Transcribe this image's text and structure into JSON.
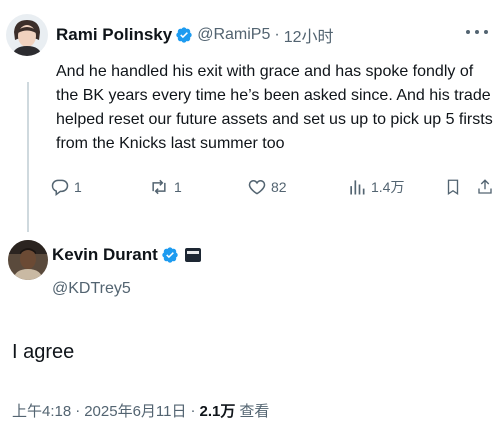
{
  "reply_tweet": {
    "author_name": "Rami Polinsky",
    "author_handle": "@RamiP5",
    "separator": "·",
    "time_ago": "12小时",
    "text": "And he handled his exit with grace and has spoke fondly of the BK years every time he’s been asked since. And his trade helped reset our future assets and set us up to pick up 5 firsts from the Knicks last summer too",
    "actions": {
      "replies": "1",
      "reposts": "1",
      "likes": "82",
      "views": "1.4万"
    }
  },
  "main_tweet": {
    "author_name": "Kevin Durant",
    "author_handle": "@KDTrey5",
    "text": "I agree",
    "time": "上午4:18",
    "date": "2025年6月11日",
    "separator": "·",
    "views_count": "2.1万",
    "views_label": "查看"
  },
  "colors": {
    "text": "#0f1419",
    "secondary": "#536471",
    "verified": "#1d9bf0",
    "thread_line": "#cfd9de"
  },
  "icons": [
    "verified-badge-icon",
    "more-icon",
    "reply-icon",
    "repost-icon",
    "like-icon",
    "views-icon",
    "bookmark-icon",
    "share-icon",
    "flag-icon"
  ]
}
